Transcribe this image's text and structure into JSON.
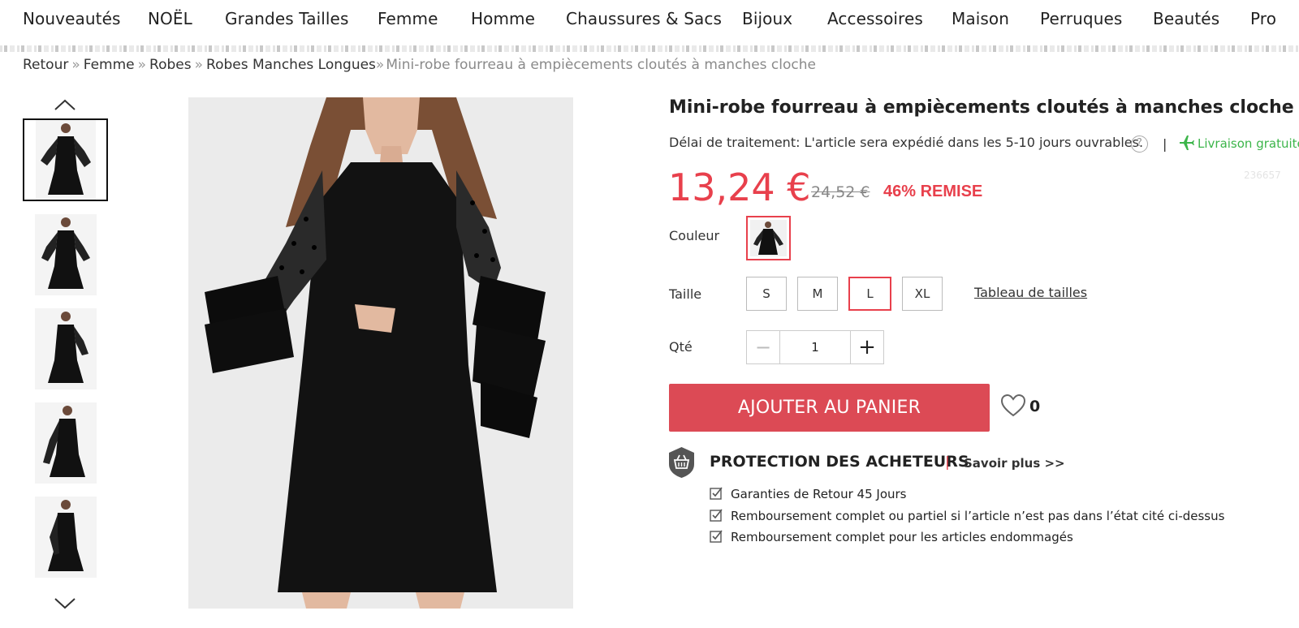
{
  "nav": {
    "items": [
      "Nouveautés",
      "NOËL",
      "Grandes Tailles",
      "Femme",
      "Homme",
      "Chaussures & Sacs",
      "Bijoux",
      "Accessoires",
      "Maison",
      "Perruques",
      "Beautés",
      "Pro"
    ]
  },
  "breadcrumb": {
    "items": [
      "Retour",
      "Femme",
      "Robes",
      "Robes Manches Longues"
    ],
    "separator": "»",
    "current": "Mini-robe fourreau à empiècements cloutés à manches cloche"
  },
  "product": {
    "title": "Mini-robe fourreau à empiècements cloutés à manches cloche",
    "processing": "Délai de traitement: L'article sera expédié dans les 5-10 jours ouvrables.",
    "help": "?",
    "pipe": "|",
    "shipping": "Livraison gratuite",
    "sku": "236657",
    "price": "13,24 €",
    "old_price": "24,52 €",
    "discount": "46% REMISE",
    "color_label": "Couleur",
    "size_label": "Taille",
    "sizes": [
      "S",
      "M",
      "L",
      "XL"
    ],
    "selected_size": "L",
    "size_chart": "Tableau de tailles",
    "qty_label": "Qté",
    "qty_minus": "−",
    "qty_value": "1",
    "qty_plus": "+",
    "add_to_cart": "AJOUTER AU PANIER",
    "favorites_count": "0"
  },
  "protection": {
    "title": "PROTECTION DES ACHETEURS",
    "separator": "|",
    "learn_more": "Savoir plus >>",
    "guarantees": [
      "Garanties de Retour 45 Jours",
      "Remboursement complet ou partiel si l’article n’est pas dans l’état cité ci-dessus",
      "Remboursement complet pour les articles endommagés"
    ]
  },
  "colors": {
    "accent": "#e8404c",
    "button": "#dc4a55",
    "shipping_green": "#3cb54a"
  },
  "icons": [
    "chevron-up-icon",
    "chevron-down-icon",
    "help-icon",
    "plane-icon",
    "heart-icon",
    "shield-basket-icon",
    "checkbox-icon"
  ]
}
